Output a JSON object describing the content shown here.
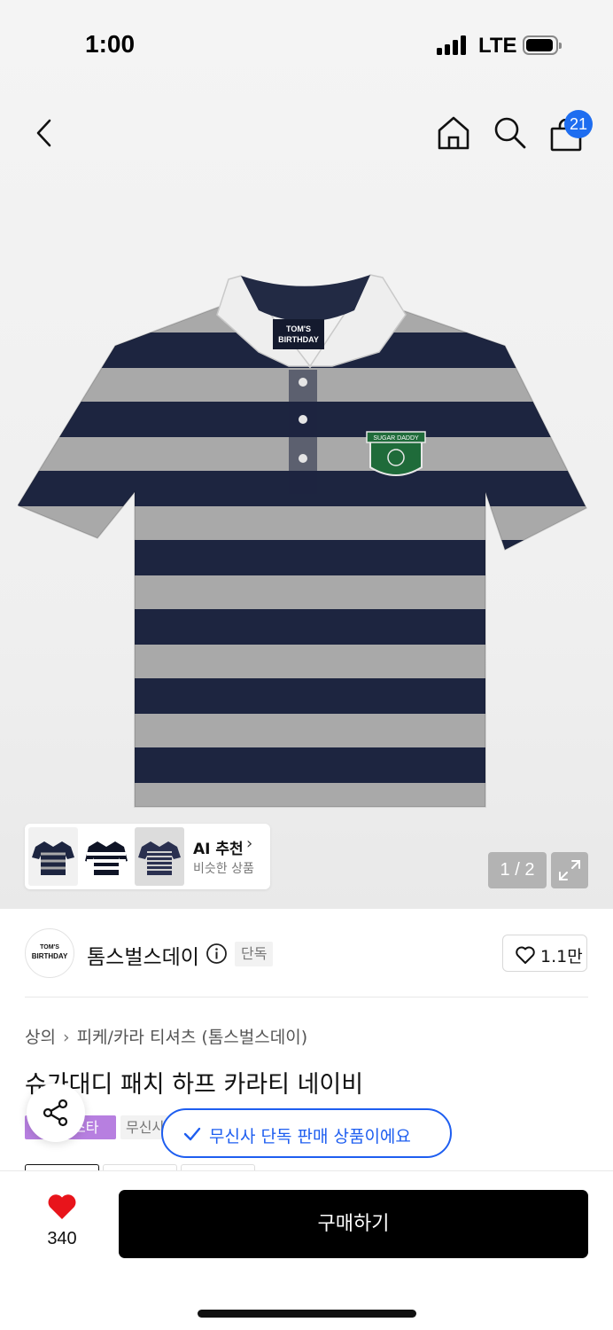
{
  "status_bar": {
    "time": "1:00",
    "network": "LTE"
  },
  "nav": {
    "cart_count": "21"
  },
  "shirt": {
    "label_line1": "TOM'S",
    "label_line2": "BIRTHDAY",
    "patch_text": "SUGAR DADDY"
  },
  "gallery": {
    "ai_title": "AI 추천",
    "ai_subtitle": "비슷한 상품",
    "page_counter": "1 / 2"
  },
  "brand": {
    "logo_line1": "TOM'S",
    "logo_line2": "BIRTHDAY",
    "name": "톰스벌스데이",
    "exclusive_tag": "단독",
    "like_count": "1.1만"
  },
  "breadcrumb": [
    "상의",
    "피케/카라 티셔츠 (톰스벌스데이)"
  ],
  "product": {
    "title": "슈가대디 패치 하프 카라티 네이비",
    "tag_purple": "스타",
    "tag_gray": "무신사"
  },
  "toast": {
    "text": "무신사 단독 판매 상품이에요"
  },
  "bottom_bar": {
    "favorite_count": "340",
    "buy_label": "구매하기"
  },
  "colors": {
    "navy": "#1d2540",
    "gray_stripe": "#a9a9a9",
    "accent_blue": "#1e5ef0",
    "purple_tag": "#b77fe0",
    "heart_red": "#e8141b"
  }
}
